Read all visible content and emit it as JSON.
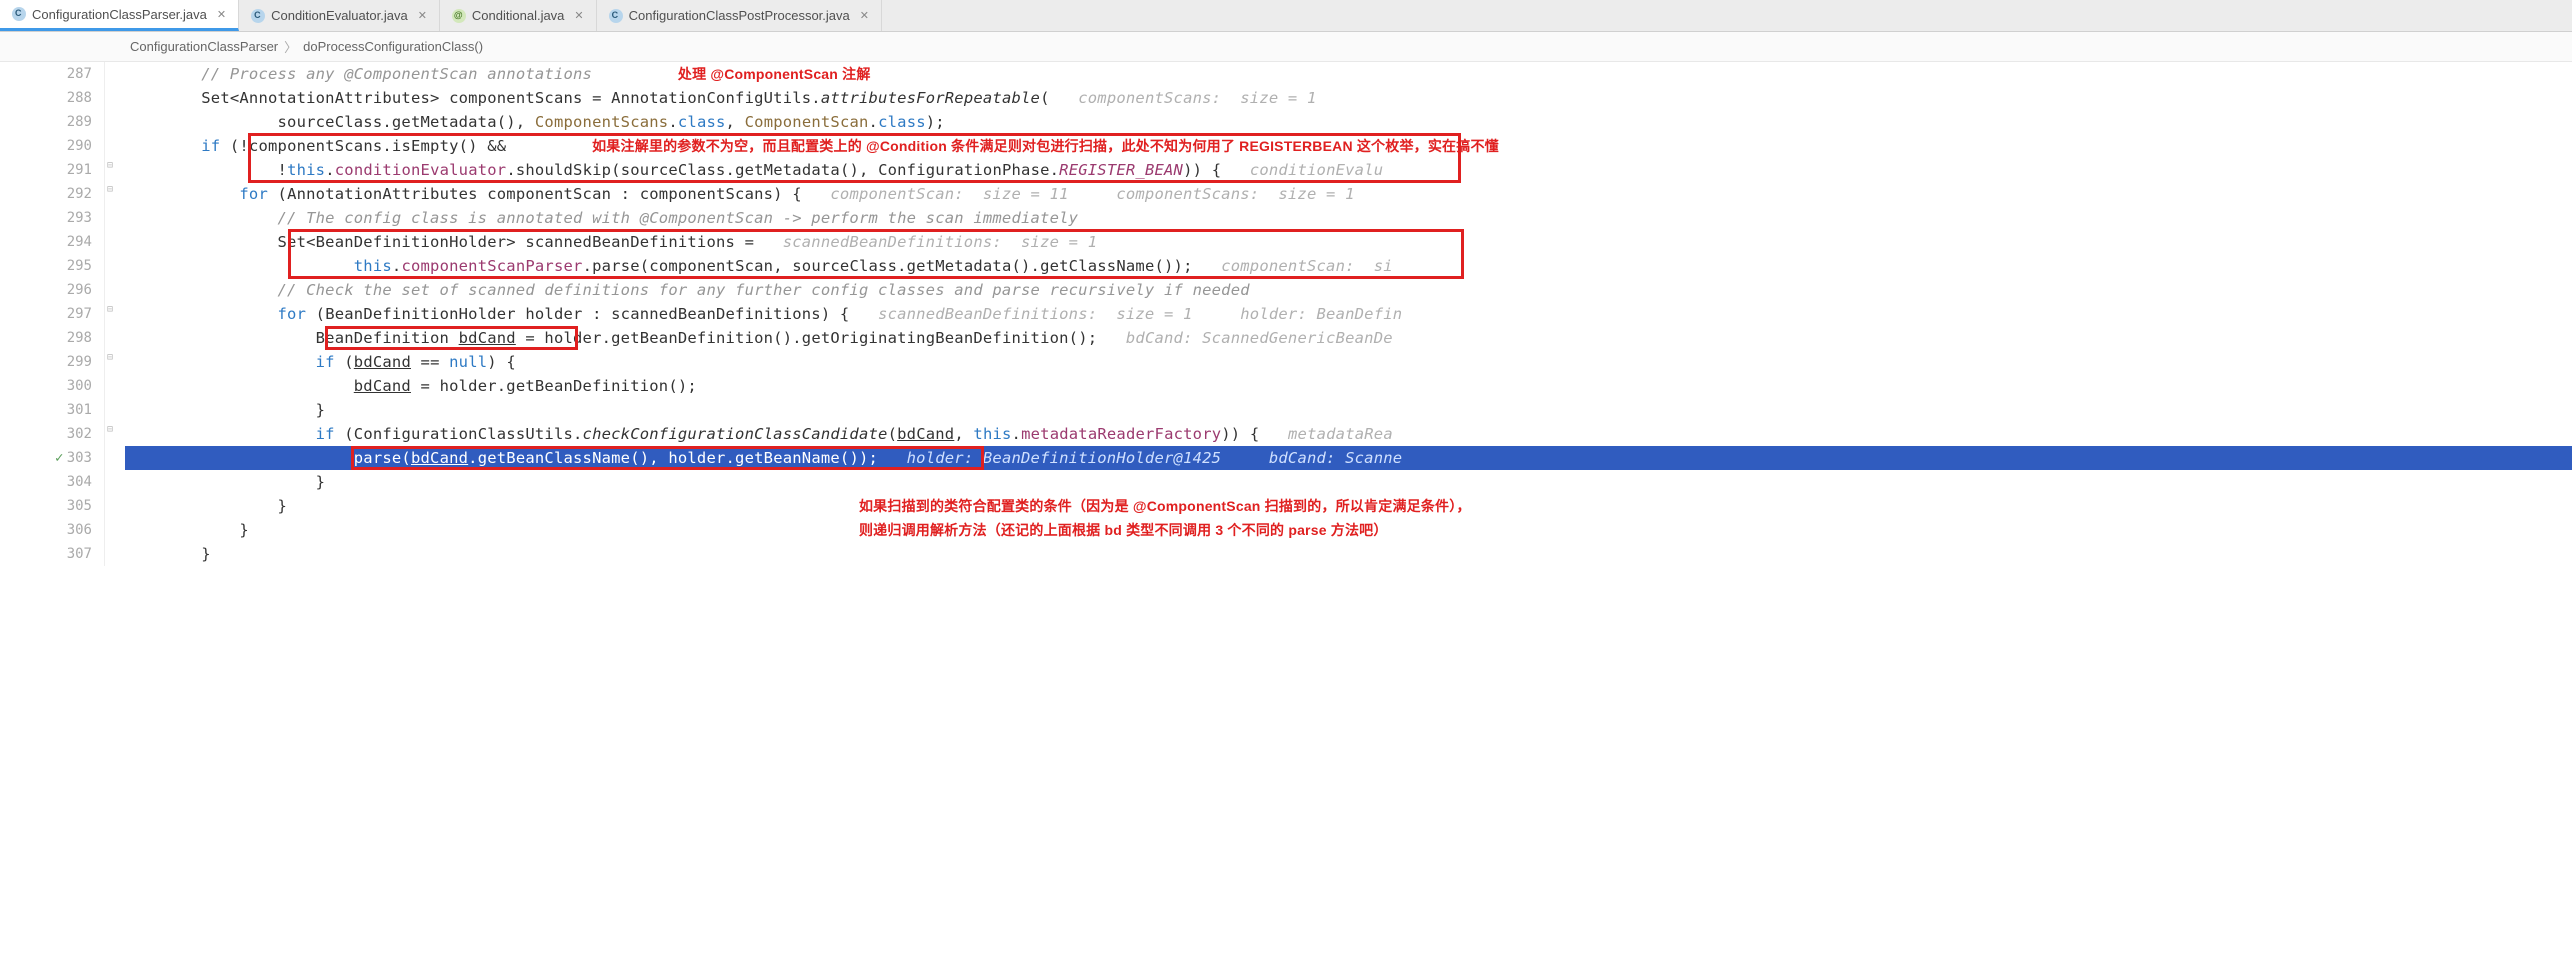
{
  "tabs": [
    {
      "label": "ConfigurationClassParser.java",
      "icon": "c",
      "active": true
    },
    {
      "label": "ConditionEvaluator.java",
      "icon": "c",
      "active": false
    },
    {
      "label": "Conditional.java",
      "icon": "i",
      "active": false
    },
    {
      "label": "ConfigurationClassPostProcessor.java",
      "icon": "c",
      "active": false
    }
  ],
  "breadcrumb": {
    "class": "ConfigurationClassParser",
    "method": "doProcessConfigurationClass()"
  },
  "lines": {
    "287": {
      "num": "287",
      "comment": "// Process any @ComponentScan annotations",
      "note1": "处理 @ComponentScan 注解"
    },
    "288": {
      "num": "288",
      "t1": "Set<AnnotationAttributes> componentScans = AnnotationConfigUtils.",
      "m": "attributesForRepeatable",
      "t2": "(",
      "hint": "   componentScans:  size = 1"
    },
    "289": {
      "num": "289",
      "t1": "sourceClass.getMetadata(), ",
      "c1": "ComponentScans",
      "t2": ".",
      "kw1": "class",
      "t3": ", ",
      "c2": "ComponentScan",
      "t4": ".",
      "kw2": "class",
      "t5": ");"
    },
    "290": {
      "num": "290",
      "kw": "if",
      "t1": " (!componentScans.isEmpty() &&",
      "note": "如果注解里的参数不为空，而且配置类上的 @Condition 条件满足则对包进行扫描，此处不知为何用了 REGISTERBEAN 这个枚举，实在搞不懂"
    },
    "291": {
      "num": "291",
      "t1": "!",
      "kw": "this",
      "t2": ".",
      "f": "conditionEvaluator",
      "t3": ".shouldSkip(sourceClass.getMetadata(), ConfigurationPhase.",
      "c": "REGISTER_BEAN",
      "t4": ")) {",
      "hint": "   conditionEvalu"
    },
    "292": {
      "num": "292",
      "kw": "for",
      "t1": " (AnnotationAttributes componentScan : componentScans) {",
      "hint1": "   componentScan:  size = 11",
      "hint2": "     componentScans:  size = 1"
    },
    "293": {
      "num": "293",
      "comment": "// The config class is annotated with @ComponentScan -> perform the scan immediately"
    },
    "294": {
      "num": "294",
      "t1": "Set<BeanDefinitionHolder> scannedBeanDefinitions =",
      "hint": "   scannedBeanDefinitions:  size = 1"
    },
    "295": {
      "num": "295",
      "kw": "this",
      "t1": ".",
      "f": "componentScanParser",
      "t2": ".parse(componentScan, sourceClass.getMetadata().getClassName());",
      "hint": "   componentScan:  si"
    },
    "296": {
      "num": "296",
      "comment": "// Check the set of scanned definitions for any further config classes and parse recursively if needed"
    },
    "297": {
      "num": "297",
      "kw": "for",
      "t1": " (BeanDefinitionHolder holder : scannedBeanDefinitions) {",
      "hint1": "   scannedBeanDefinitions:  size = 1",
      "hint2": "     holder: BeanDefin"
    },
    "298": {
      "num": "298",
      "t1": "BeanDefinition ",
      "u": "bdCand",
      "t2": " = holder.getBeanDefinition().getOriginatingBeanDefinition();",
      "hint": "   bdCand: ScannedGenericBeanDe"
    },
    "299": {
      "num": "299",
      "kw": "if",
      "t1": " (",
      "u": "bdCand",
      "t2": " == ",
      "kw2": "null",
      "t3": ") {"
    },
    "300": {
      "num": "300",
      "u": "bdCand",
      "t1": " = holder.getBeanDefinition();"
    },
    "301": {
      "num": "301",
      "t": "}"
    },
    "302": {
      "num": "302",
      "kw": "if",
      "t1": " (ConfigurationClassUtils.",
      "m": "checkConfigurationClassCandidate",
      "t2": "(",
      "u": "bdCand",
      "t3": ", ",
      "kw2": "this",
      "t4": ".",
      "f": "metadataReaderFactory",
      "t5": ")) {",
      "hint": "   metadataRea"
    },
    "303": {
      "num": "303",
      "t1": "parse(",
      "u1": "bdCand",
      "t2": ".getBeanClassName(), holder.getBeanName());",
      "hint1": "   holder: BeanDefinitionHolder@1425",
      "hint2": "     bdCand: Scanne"
    },
    "304": {
      "num": "304",
      "t": "}"
    },
    "305": {
      "num": "305",
      "t": "}",
      "note1": "如果扫描到的类符合配置类的条件（因为是 @ComponentScan 扫描到的，所以肯定满足条件），"
    },
    "306": {
      "num": "306",
      "t": "}",
      "note1": "则递归调用解析方法（还记的上面根据 bd 类型不同调用 3 个不同的 parse 方法吧）"
    },
    "307": {
      "num": "307",
      "t": "}"
    }
  }
}
